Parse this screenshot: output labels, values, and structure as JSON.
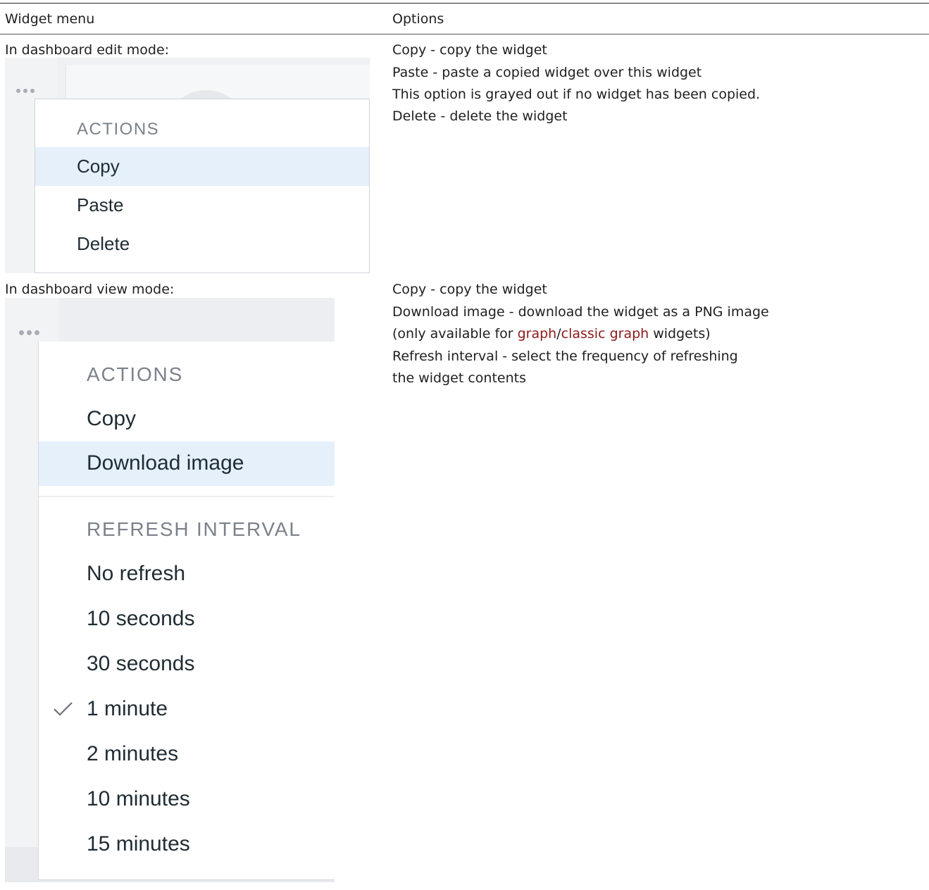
{
  "table": {
    "headers": [
      "Widget menu",
      "Options"
    ],
    "rows": [
      {
        "caption": "In dashboard edit mode:",
        "options": [
          "Copy - copy the widget",
          "Paste - paste a copied widget over this widget",
          "This option is grayed out if no widget has been copied.",
          "Delete - delete the widget"
        ]
      },
      {
        "caption": "In dashboard view mode:",
        "options_line1": "Copy - copy the widget",
        "options_line2": "Download image - download the widget as a PNG image",
        "options_line3": {
          "prefix": "(only available for ",
          "link1": "graph",
          "sep": "/",
          "link2": "classic graph",
          "suffix": " widgets)"
        },
        "options_line4": "Refresh interval - select the frequency of refreshing",
        "options_line5": "the widget contents"
      }
    ]
  },
  "edit_menu": {
    "section_title": "ACTIONS",
    "items": [
      "Copy",
      "Paste",
      "Delete"
    ],
    "highlighted_item": "Copy"
  },
  "view_menu": {
    "actions_title": "ACTIONS",
    "actions": [
      "Copy",
      "Download image"
    ],
    "highlighted_item": "Download image",
    "refresh_title": "REFRESH INTERVAL",
    "refresh_options": [
      "No refresh",
      "10 seconds",
      "30 seconds",
      "1 minute",
      "2 minutes",
      "10 minutes",
      "15 minutes"
    ],
    "checked_option": "1 minute"
  },
  "colors": {
    "link": "#8b1a1a",
    "menu_highlight": "#e5f0fb",
    "section_title": "#7b818a"
  },
  "icons": [
    "more-dots-icon",
    "checkmark-icon"
  ]
}
